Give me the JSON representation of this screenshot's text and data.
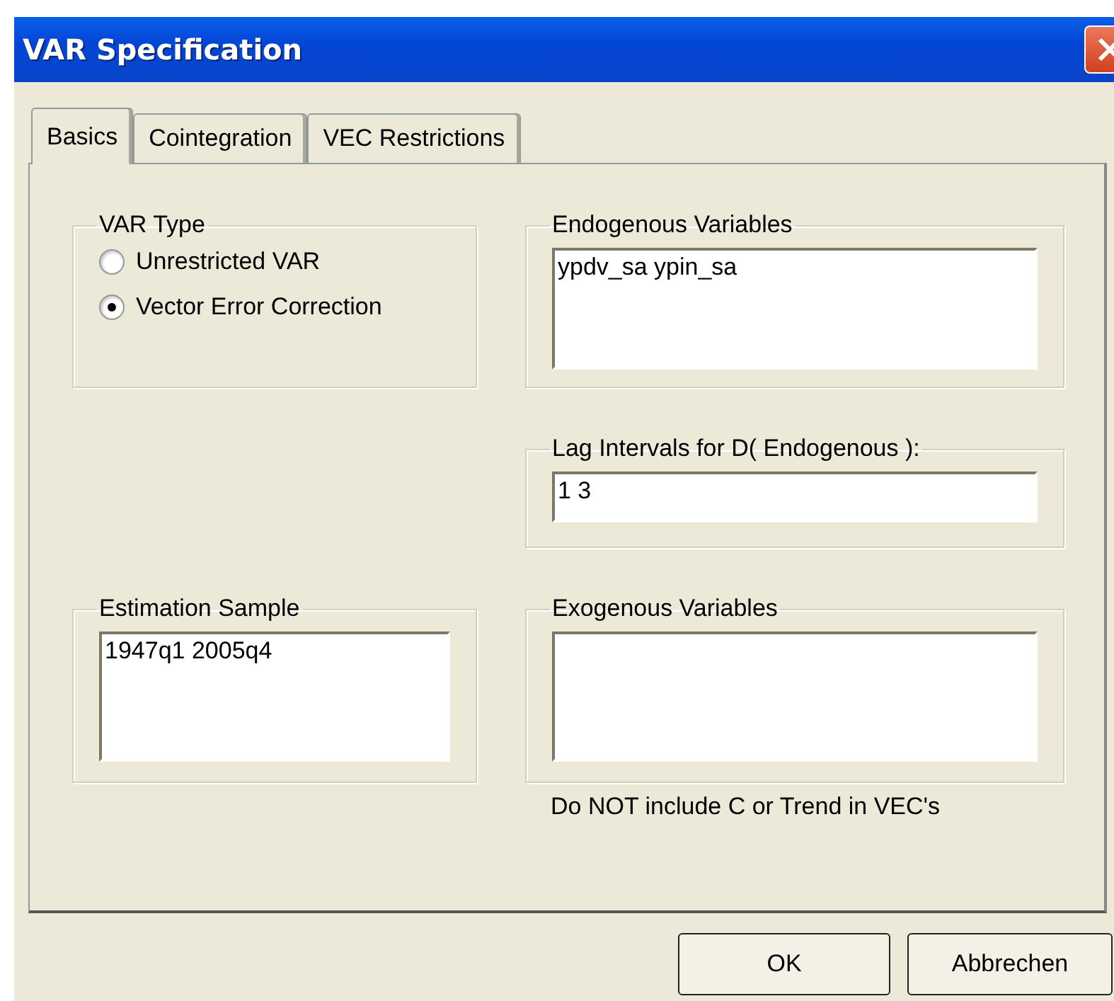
{
  "window": {
    "title": "VAR Specification"
  },
  "tabs": [
    {
      "label": "Basics",
      "selected": true
    },
    {
      "label": "Cointegration",
      "selected": false
    },
    {
      "label": "VEC Restrictions",
      "selected": false
    }
  ],
  "var_type": {
    "legend": "VAR Type",
    "options": [
      {
        "label": "Unrestricted VAR",
        "selected": false
      },
      {
        "label": "Vector Error Correction",
        "selected": true
      }
    ]
  },
  "endogenous": {
    "legend": "Endogenous Variables",
    "value": "ypdv_sa ypin_sa"
  },
  "lag_intervals": {
    "legend": "Lag Intervals for D( Endogenous ):",
    "value": "1 3"
  },
  "estimation_sample": {
    "legend": "Estimation Sample",
    "value": "1947q1 2005q4"
  },
  "exogenous": {
    "legend": "Exogenous Variables",
    "note": "Do NOT include C or Trend in VEC's"
  },
  "buttons": [
    "OK",
    "Abbrechen"
  ]
}
